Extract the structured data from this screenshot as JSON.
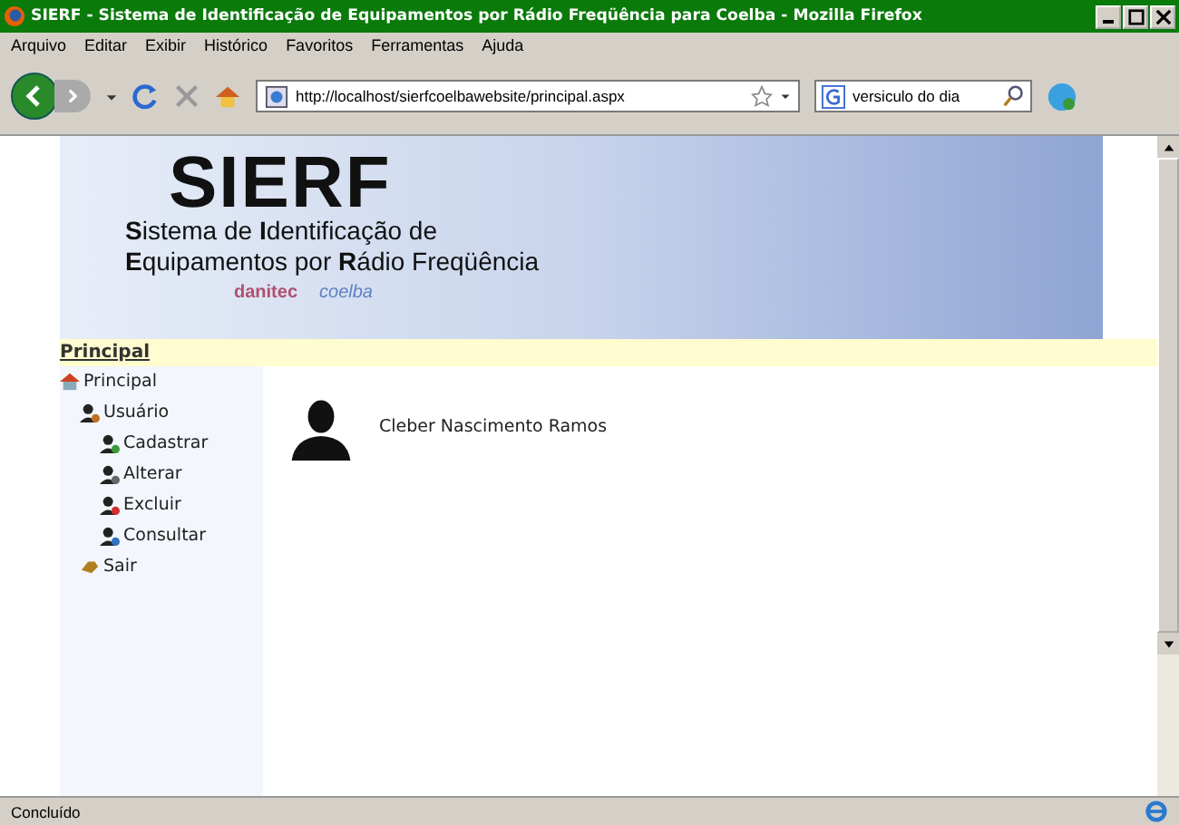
{
  "window": {
    "title": "SIERF - Sistema de Identificação de Equipamentos por Rádio Freqüência para Coelba - Mozilla Firefox"
  },
  "menu": [
    "Arquivo",
    "Editar",
    "Exibir",
    "Histórico",
    "Favoritos",
    "Ferramentas",
    "Ajuda"
  ],
  "toolbar": {
    "url": "http://localhost/sierfcoelbawebsite/principal.aspx",
    "search_value": "versiculo do dia"
  },
  "banner": {
    "logo": "SIERF",
    "subtitle_lines": [
      "**S**istema de **I**dentificação de",
      "**E**quipamentos por **R**ádio Freqüência"
    ],
    "partners": [
      "danitec",
      "coelba"
    ]
  },
  "breadcrumb": "Principal",
  "sidebar": {
    "items": [
      {
        "label": "Principal",
        "children": [
          {
            "label": "Usuário",
            "children": [
              {
                "label": "Cadastrar"
              },
              {
                "label": "Alterar"
              },
              {
                "label": "Excluir"
              },
              {
                "label": "Consultar"
              }
            ]
          },
          {
            "label": "Sair"
          }
        ]
      }
    ]
  },
  "user": {
    "name": "Cleber Nascimento Ramos"
  },
  "status_bar": "Concluído"
}
